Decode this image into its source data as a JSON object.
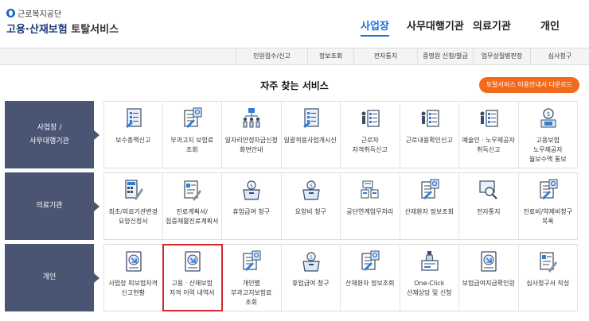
{
  "logo": {
    "top": "근로복지공단",
    "name": "고용·산재보험",
    "service": "토탈서비스"
  },
  "topnav": [
    {
      "label": "사업장",
      "active": true
    },
    {
      "label": "사무대행기관",
      "active": false
    },
    {
      "label": "의료기관",
      "active": false
    },
    {
      "label": "개인",
      "active": false
    }
  ],
  "subbar": [
    "민원접수/신고",
    "정보조회",
    "전자통지",
    "증명원 신청/발급",
    "업무상질병판정",
    "심사청구"
  ],
  "section_title": "자주 찾는 서비스",
  "download_button": "토탈서비스 이용안내서 다운로드",
  "rows": [
    {
      "label": "사업장 /\n사무대행기관",
      "items": [
        {
          "label": "보수총액신고",
          "icon": "document-list-icon"
        },
        {
          "label": "부과고지 보험료 조회",
          "icon": "document-search-icon"
        },
        {
          "label": "일자리안정자금신청 화면안내",
          "icon": "people-org-icon"
        },
        {
          "label": "일괄적용사업개시신고",
          "icon": "document-list-icon"
        },
        {
          "label": "근로자 자격취득신고",
          "icon": "workers-document-icon"
        },
        {
          "label": "근로내용확인신고",
          "icon": "workers-document-icon"
        },
        {
          "label": "예술인ㆍ노무제공자 취득신고",
          "icon": "workers-document-icon"
        },
        {
          "label": "고용보험 노무제공자 월보수액 통보",
          "icon": "money-person-icon"
        }
      ]
    },
    {
      "label": "의료기관",
      "items": [
        {
          "label": "최초/의료기관변경 요양신청서",
          "icon": "calculator-pen-icon"
        },
        {
          "label": "진료계획서/집중재활진료계획서",
          "icon": "document-pen-icon"
        },
        {
          "label": "휴업급여 청구",
          "icon": "money-box-icon"
        },
        {
          "label": "요양비 청구",
          "icon": "money-box-icon"
        },
        {
          "label": "공단연계업무처리",
          "icon": "network-document-icon"
        },
        {
          "label": "산재환자 정보조회",
          "icon": "document-search-icon"
        },
        {
          "label": "전자통지",
          "icon": "magnifier-screen-icon"
        },
        {
          "label": "진료비/약제비청구 목록",
          "icon": "document-search-icon"
        }
      ]
    },
    {
      "label": "개인",
      "items": [
        {
          "label": "사업장 피보험자격 신고현황",
          "icon": "download-document-icon",
          "highlight": false
        },
        {
          "label": "고용ㆍ산재보험 자격 이력 내역서",
          "icon": "download-document-icon",
          "highlight": true
        },
        {
          "label": "개인별 부과고지보험료 조회",
          "icon": "document-search-icon",
          "highlight": false
        },
        {
          "label": "휴업급여 청구",
          "icon": "money-box-icon",
          "highlight": false
        },
        {
          "label": "산재환자 정보조회",
          "icon": "document-search-icon",
          "highlight": false
        },
        {
          "label": "One-Click 산재상담 및 신청",
          "icon": "bottle-document-icon",
          "highlight": false
        },
        {
          "label": "보험급여지급확인원",
          "icon": "download-document-icon",
          "highlight": false
        },
        {
          "label": "심사청구서 작성",
          "icon": "document-pen-icon",
          "highlight": false
        }
      ]
    }
  ]
}
